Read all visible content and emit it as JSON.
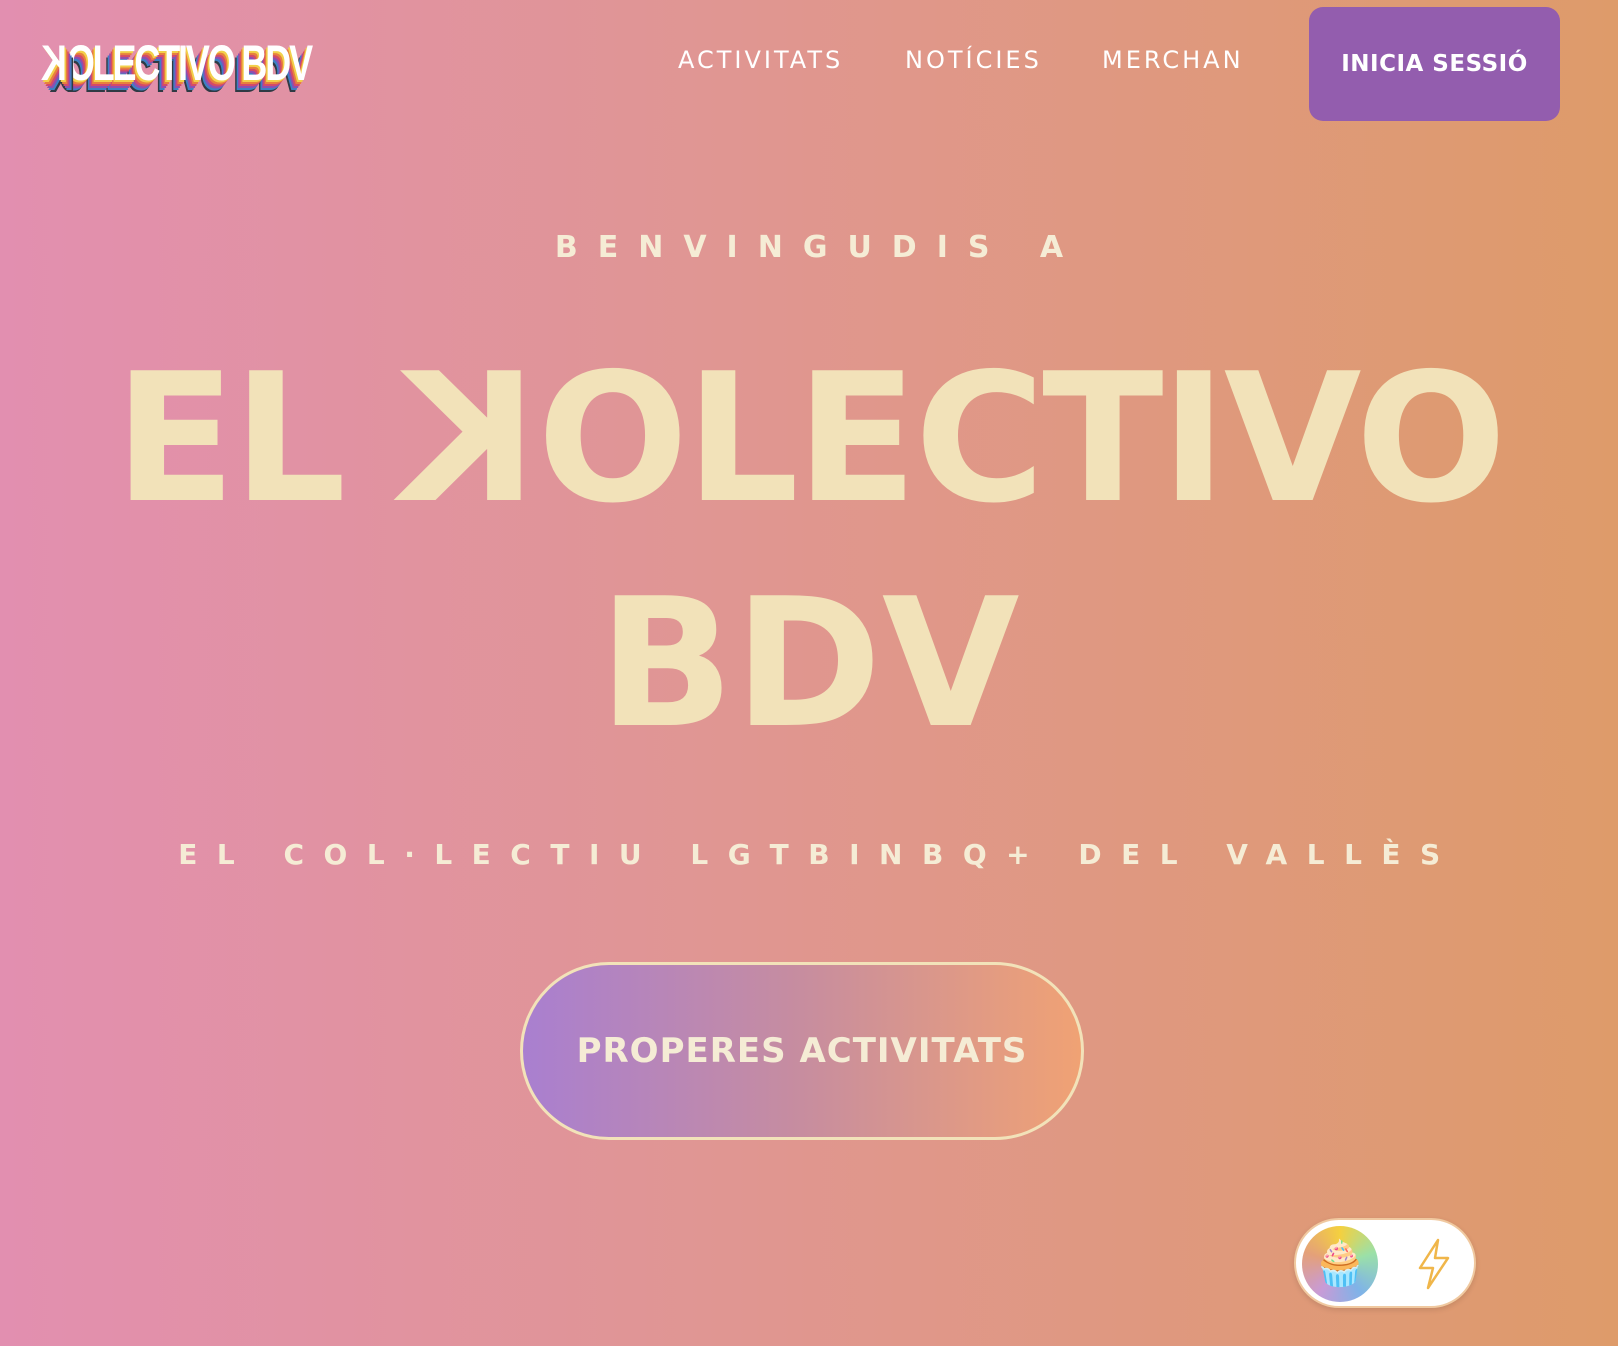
{
  "header": {
    "logo_text_k": "K",
    "logo_text_rest": "OLECTIVO BDV",
    "nav": [
      {
        "label": "ACTIVITATS"
      },
      {
        "label": "NOTÍCIES"
      },
      {
        "label": "MERCHAN"
      }
    ],
    "login_label": "INICIA SESSIÓ"
  },
  "hero": {
    "welcome": "BENVINGUDIS A",
    "title_line1_prefix": "EL ",
    "title_line1_k": "K",
    "title_line1_rest": "OLECTIVO",
    "title_line2": "BDV",
    "subtitle": "EL COL·LECTIU LGTBINBQ+ DEL VALLÈS",
    "cta_label": "PROPERES ACTIVITATS"
  },
  "theme_toggle": {
    "knob_icon": "cupcake-icon",
    "knob_glyph": "🧁",
    "alt_icon": "lightning-icon"
  },
  "colors": {
    "login_button": "#935dae",
    "hero_text": "#f2e2b9",
    "background_left": "#e28fb0",
    "background_right": "#de9b6a"
  }
}
